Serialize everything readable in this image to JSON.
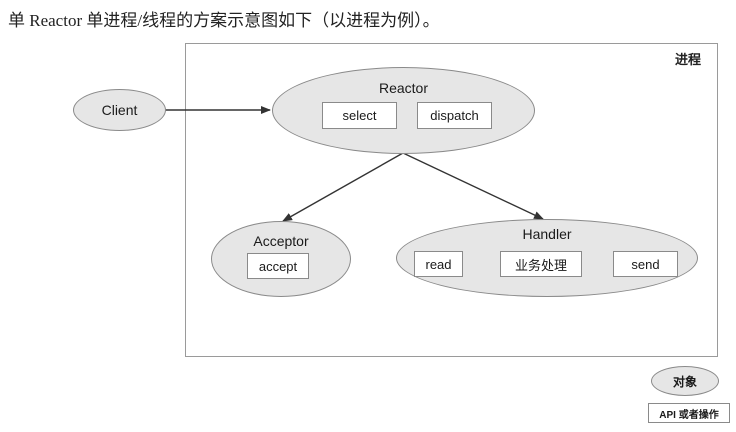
{
  "caption": "单 Reactor 单进程/线程的方案示意图如下（以进程为例）。",
  "process_label": "进程",
  "client": {
    "label": "Client"
  },
  "reactor": {
    "title": "Reactor",
    "select_label": "select",
    "dispatch_label": "dispatch"
  },
  "acceptor": {
    "title": "Acceptor",
    "accept_label": "accept"
  },
  "handler": {
    "title": "Handler",
    "read_label": "read",
    "business_label": "业务处理",
    "send_label": "send"
  },
  "legend": {
    "object_label": "对象",
    "api_label": "API 或者操作"
  },
  "colors": {
    "ellipse_fill": "#e6e6e6",
    "stroke": "#8a8a8a",
    "arrow": "#333333"
  }
}
